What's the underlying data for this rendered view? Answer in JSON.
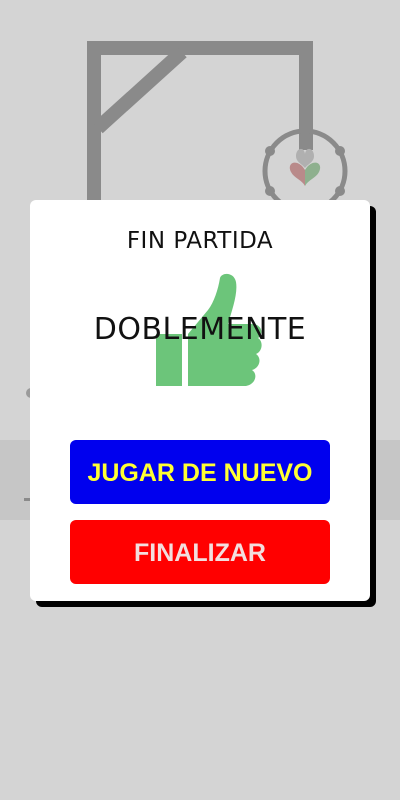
{
  "dialog": {
    "title": "FIN PARTIDA",
    "result_word": "DOBLEMENTE",
    "play_again_label": "JUGAR DE NUEVO",
    "finish_label": "FINALIZAR"
  },
  "icons": {
    "result_icon": "thumbs-up-icon",
    "app_logo": "hearts-logo-icon"
  },
  "colors": {
    "play_again_bg": "#0000ee",
    "play_again_text": "#ffff33",
    "finish_bg": "#ff0000",
    "thumb": "#6cc57a"
  }
}
